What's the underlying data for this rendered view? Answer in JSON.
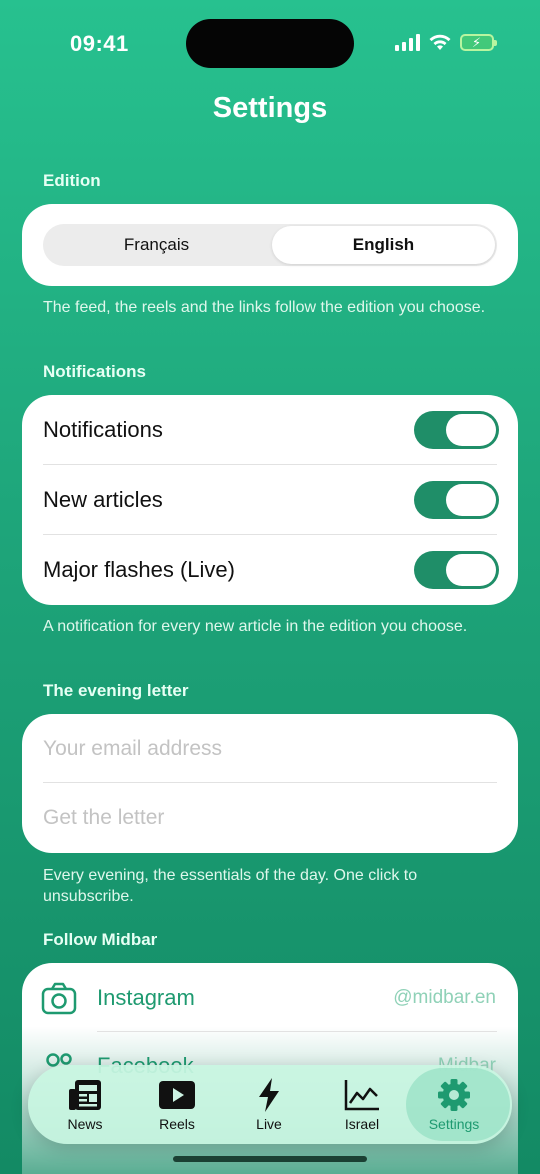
{
  "status": {
    "time": "09:41",
    "icons": [
      "signal-icon",
      "wifi-icon",
      "battery-charging-icon"
    ]
  },
  "page": {
    "title": "Settings"
  },
  "edition": {
    "section_label": "Edition",
    "options": [
      "Français",
      "English"
    ],
    "selected": "English",
    "footnote": "The feed, the reels and the links follow the edition you choose."
  },
  "notifications": {
    "section_label": "Notifications",
    "rows": [
      {
        "label": "Notifications",
        "on": true
      },
      {
        "label": "New articles",
        "on": true
      },
      {
        "label": "Major flashes (Live)",
        "on": true
      }
    ],
    "footnote": "A notification for every new article in the edition you choose."
  },
  "evening_letter": {
    "section_label": "The evening letter",
    "email_placeholder": "Your email address",
    "action_label": "Get the letter",
    "footnote": "Every evening, the essentials of the day. One click to unsubscribe."
  },
  "follow": {
    "section_label": "Follow Midbar",
    "items": [
      {
        "label": "Instagram",
        "handle": "@midbar.en",
        "icon": "camera-icon"
      },
      {
        "label": "Facebook",
        "handle": "Midbar",
        "icon": "people-icon"
      }
    ]
  },
  "tabbar": {
    "active": "Settings",
    "tabs": [
      {
        "label": "News",
        "icon": "newspaper-icon"
      },
      {
        "label": "Reels",
        "icon": "play-icon"
      },
      {
        "label": "Live",
        "icon": "bolt-icon"
      },
      {
        "label": "Israel",
        "icon": "line-chart-icon"
      },
      {
        "label": "Settings",
        "icon": "gear-icon"
      }
    ]
  },
  "colors": {
    "accent": "#1e9a70",
    "background_top": "#27c18f",
    "background_bottom": "#138a64",
    "toggle_on": "#1f8e68"
  }
}
